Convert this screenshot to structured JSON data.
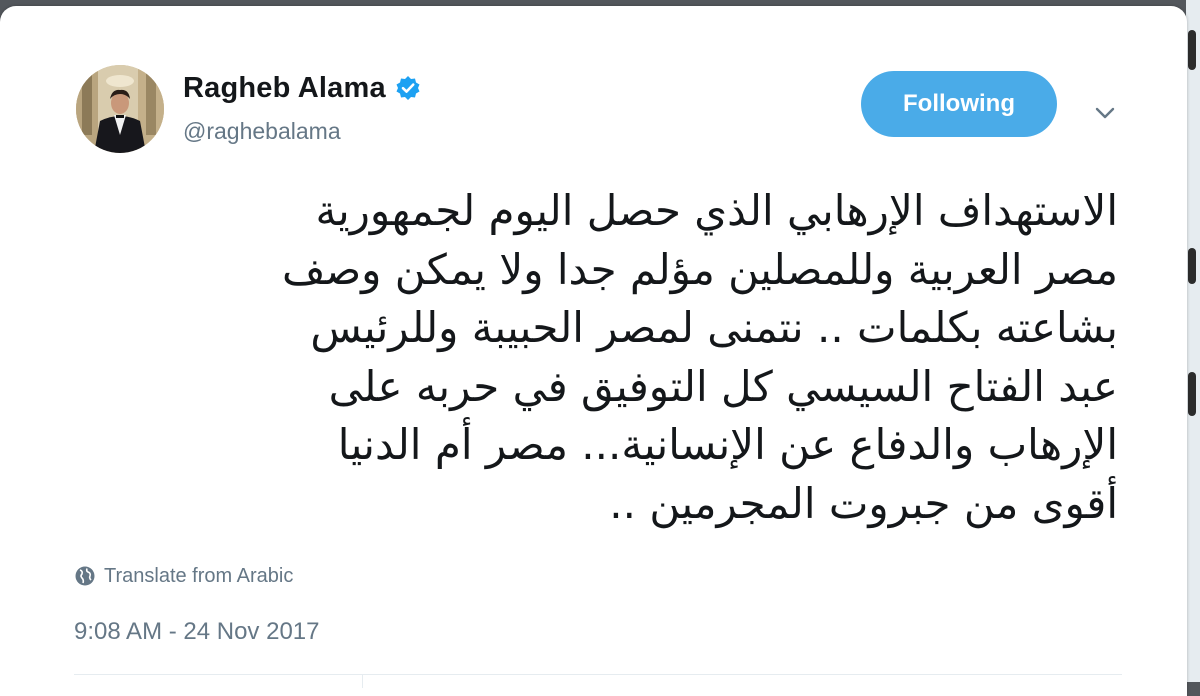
{
  "tweet": {
    "author": {
      "display_name": "Ragheb Alama",
      "handle": "@raghebalama",
      "verified": true
    },
    "follow_button_label": "Following",
    "text_lines": [
      "الاستهداف الإرهابي الذي حصل اليوم  لجمهورية",
      "مصر العربية وللمصلين مؤلم جدا ولا يمكن وصف",
      "بشاعته بكلمات .. نتمنى لمصر  الحبيبة وللرئيس",
      "عبد الفتاح السيسي كل التوفيق في حربه على",
      "الإرهاب  والدفاع عن الإنسانية... مصر أم الدنيا",
      "أقوى من جبروت المجرمين  .."
    ],
    "translate_label": "Translate from Arabic",
    "timestamp": "9:08 AM - 24 Nov 2017"
  },
  "icons": {
    "verified": "verified-badge-icon",
    "caret": "chevron-down-icon",
    "globe": "globe-icon"
  },
  "colors": {
    "accent": "#4aabe8",
    "verified": "#1da1f2",
    "text": "#14171a",
    "secondary_text": "#657786",
    "backdrop": "#53575c"
  }
}
